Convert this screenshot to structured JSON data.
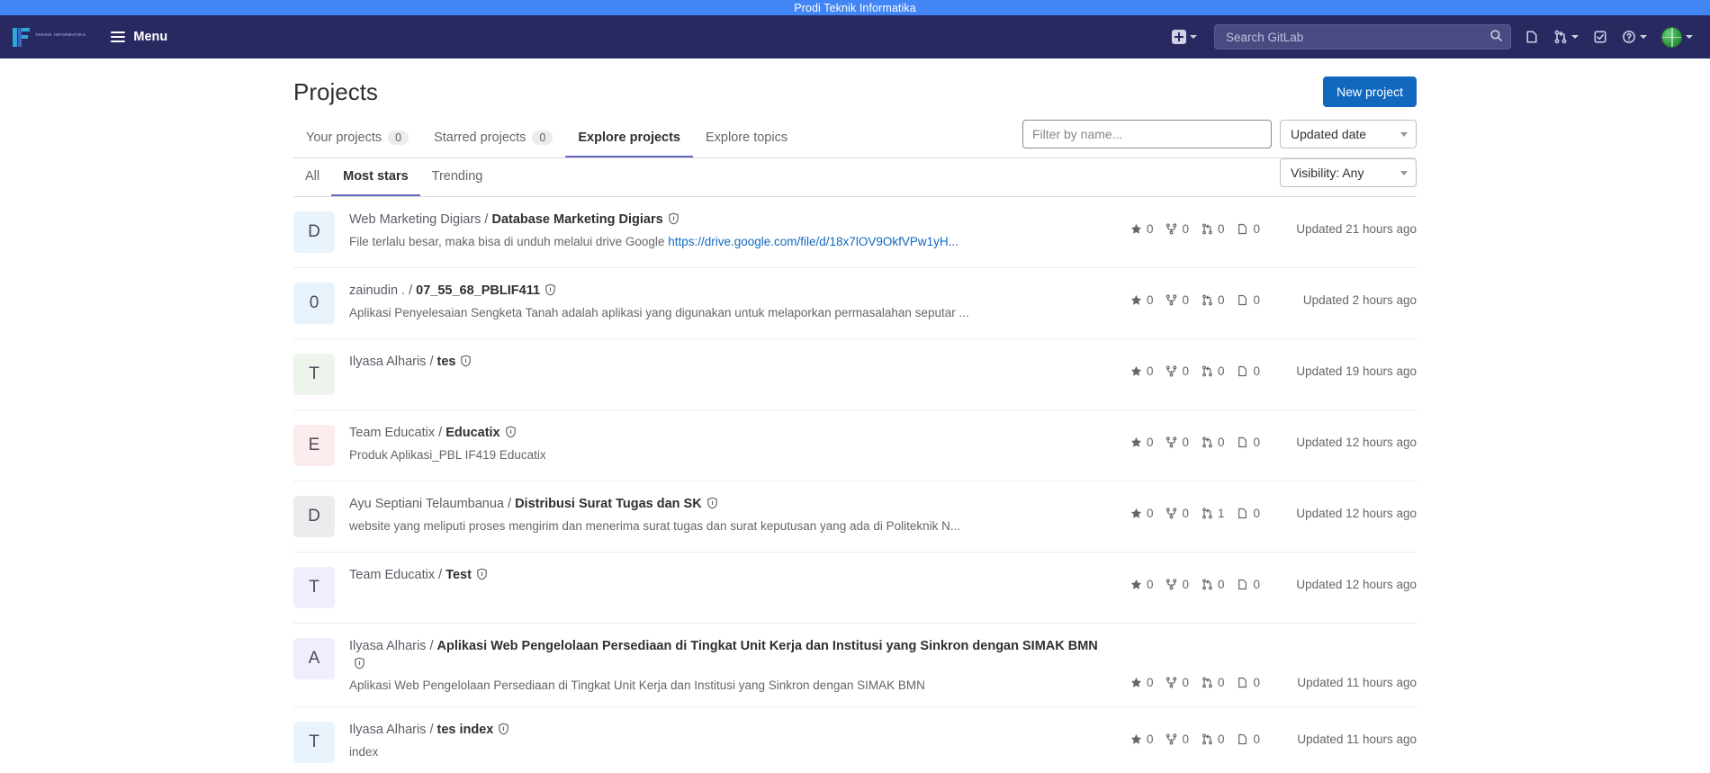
{
  "announcement": {
    "text": "Prodi Teknik Informatika"
  },
  "navbar": {
    "brand": {
      "logo_initials": "IF",
      "logo_subtitle": "TEKNIK INFORMATIKA"
    },
    "menu_label": "Menu",
    "search_placeholder": "Search GitLab",
    "icons": {
      "create_new": "plus-square-icon",
      "create_new_chevron": "chevron-down-icon",
      "search": "search-icon",
      "issues": "issues-icon",
      "merge_requests": "merge-request-icon",
      "merge_requests_chevron": "chevron-down-icon",
      "todos": "todo-check-icon",
      "help": "help-circle-icon",
      "help_chevron": "chevron-down-icon",
      "avatar": "user-avatar",
      "avatar_chevron": "chevron-down-icon"
    }
  },
  "page": {
    "title": "Projects",
    "new_project_label": "New project"
  },
  "tabs": [
    {
      "label": "Your projects",
      "badge": "0",
      "active": false
    },
    {
      "label": "Starred projects",
      "badge": "0",
      "active": false
    },
    {
      "label": "Explore projects",
      "badge": "",
      "active": true
    },
    {
      "label": "Explore topics",
      "badge": "",
      "active": false
    }
  ],
  "filters": {
    "name_placeholder": "Filter by name...",
    "name_value": "",
    "sort_label": "Updated date",
    "visibility_label": "Visibility: Any"
  },
  "subtabs": [
    {
      "label": "All",
      "active": false
    },
    {
      "label": "Most stars",
      "active": true
    },
    {
      "label": "Trending",
      "active": false
    }
  ],
  "projects": [
    {
      "avatar_letter": "D",
      "avatar_bg": "#e9f3fc",
      "namespace": "Web Marketing Digiars / ",
      "name": "Database Marketing Digiars",
      "description": "File terlalu besar, maka bisa di unduh melalui drive Google ",
      "link_text": "https://drive.google.com/file/d/18x7lOV9OkfVPw1yH...",
      "stars": "0",
      "forks": "0",
      "merge_requests": "0",
      "issues": "0",
      "updated": "Updated 21 hours ago",
      "tall": false
    },
    {
      "avatar_letter": "0",
      "avatar_bg": "#e9f3fc",
      "namespace": "zainudin . / ",
      "name": "07_55_68_PBLIF411",
      "description": "Aplikasi Penyelesaian Sengketa Tanah adalah aplikasi yang digunakan untuk melaporkan permasalahan seputar ...",
      "link_text": "",
      "stars": "0",
      "forks": "0",
      "merge_requests": "0",
      "issues": "0",
      "updated": "Updated 2 hours ago",
      "tall": false
    },
    {
      "avatar_letter": "T",
      "avatar_bg": "#ecf4ec",
      "namespace": "Ilyasa Alharis / ",
      "name": "tes",
      "description": "",
      "link_text": "",
      "stars": "0",
      "forks": "0",
      "merge_requests": "0",
      "issues": "0",
      "updated": "Updated 19 hours ago",
      "tall": false
    },
    {
      "avatar_letter": "E",
      "avatar_bg": "#fceced",
      "namespace": "Team Educatix / ",
      "name": "Educatix",
      "description": "Produk Aplikasi_PBL IF419 Educatix",
      "link_text": "",
      "stars": "0",
      "forks": "0",
      "merge_requests": "0",
      "issues": "0",
      "updated": "Updated 12 hours ago",
      "tall": false
    },
    {
      "avatar_letter": "D",
      "avatar_bg": "#ececef",
      "namespace": "Ayu Septiani Telaumbanua / ",
      "name": "Distribusi Surat Tugas dan SK",
      "description": "website yang meliputi proses mengirim dan menerima surat tugas dan surat keputusan yang ada di Politeknik N...",
      "link_text": "",
      "stars": "0",
      "forks": "0",
      "merge_requests": "1",
      "issues": "0",
      "updated": "Updated 12 hours ago",
      "tall": false
    },
    {
      "avatar_letter": "T",
      "avatar_bg": "#f0edfc",
      "namespace": "Team Educatix / ",
      "name": "Test",
      "description": "",
      "link_text": "",
      "stars": "0",
      "forks": "0",
      "merge_requests": "0",
      "issues": "0",
      "updated": "Updated 12 hours ago",
      "tall": false
    },
    {
      "avatar_letter": "A",
      "avatar_bg": "#f0edfc",
      "namespace": "Ilyasa Alharis / ",
      "name": "Aplikasi Web Pengelolaan Persediaan di Tingkat Unit Kerja dan Institusi yang Sinkron dengan SIMAK BMN",
      "description": "Aplikasi Web Pengelolaan Persediaan di Tingkat Unit Kerja dan Institusi yang Sinkron dengan SIMAK BMN",
      "link_text": "",
      "stars": "0",
      "forks": "0",
      "merge_requests": "0",
      "issues": "0",
      "updated": "Updated 11 hours ago",
      "tall": true
    },
    {
      "avatar_letter": "T",
      "avatar_bg": "#e9f3fc",
      "namespace": "Ilyasa Alharis / ",
      "name": "tes index",
      "description": "index",
      "link_text": "",
      "stars": "0",
      "forks": "0",
      "merge_requests": "0",
      "issues": "0",
      "updated": "Updated 11 hours ago",
      "tall": false
    }
  ],
  "colors": {
    "navbar_bg": "#292961",
    "announcement_bg": "#4285f4",
    "accent": "#6666c4",
    "primary_button": "#1068bf",
    "link": "#1068bf"
  }
}
